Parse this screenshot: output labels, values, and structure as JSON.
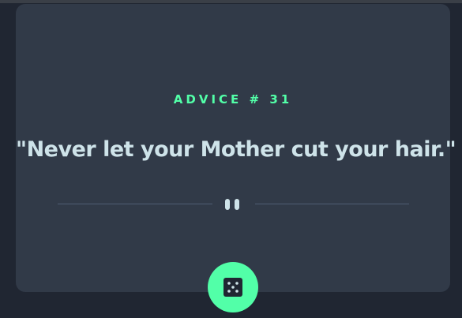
{
  "advice": {
    "label": "ADVICE # 31",
    "quote": "\"Never let your Mother cut your hair.\""
  },
  "colors": {
    "background": "#202632",
    "card": "#313a48",
    "accent": "#52ffa8",
    "text": "#cee3e9",
    "divider": "#4f5d74"
  },
  "icons": {
    "divider": "pause-icon",
    "button": "dice-icon"
  }
}
